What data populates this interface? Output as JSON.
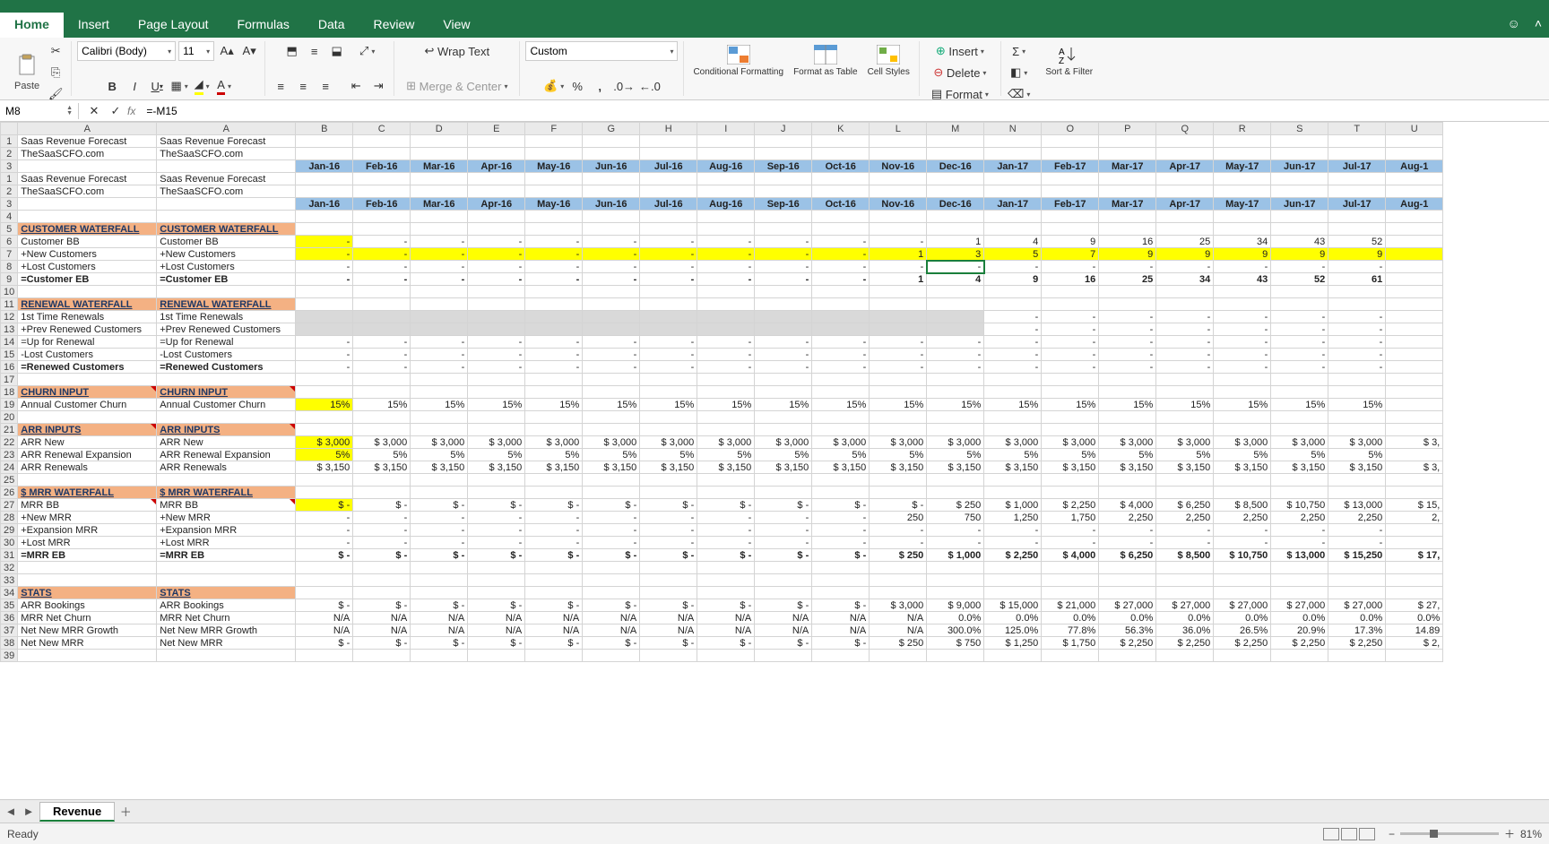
{
  "window": {
    "face_icon": "☺",
    "chevron": "˄",
    "close": "✕"
  },
  "tabs": [
    "Home",
    "Insert",
    "Page Layout",
    "Formulas",
    "Data",
    "Review",
    "View"
  ],
  "active_tab": 0,
  "ribbon": {
    "paste": "Paste",
    "font_family": "Calibri (Body)",
    "font_size": "11",
    "wrap": "Wrap Text",
    "merge": "Merge & Center",
    "num_format": "Custom",
    "cond": "Conditional Formatting",
    "fmt_tbl": "Format as Table",
    "cell_st": "Cell Styles",
    "insert": "Insert",
    "delete": "Delete",
    "format": "Format",
    "sort": "Sort & Filter"
  },
  "name_box": "M8",
  "formula": "=-M15",
  "columns": [
    "",
    "A",
    "A",
    "B",
    "C",
    "D",
    "E",
    "F",
    "G",
    "H",
    "I",
    "J",
    "K",
    "L",
    "M",
    "N",
    "O",
    "P",
    "Q",
    "R",
    "S",
    "T",
    "U"
  ],
  "months": [
    "Jan-16",
    "Feb-16",
    "Mar-16",
    "Apr-16",
    "May-16",
    "Jun-16",
    "Jul-16",
    "Aug-16",
    "Sep-16",
    "Oct-16",
    "Nov-16",
    "Dec-16",
    "Jan-17",
    "Feb-17",
    "Mar-17",
    "Apr-17",
    "May-17",
    "Jun-17",
    "Jul-17",
    "Aug-1"
  ],
  "rowLabels": {
    "title": "Saas Revenue Forecast",
    "src": "TheSaaSCFO.com",
    "cw": "CUSTOMER WATERFALL",
    "cbb": "Customer BB",
    "nc": "+New Customers",
    "lc": "+Lost Customers",
    "ceb": "=Customer EB",
    "rw": "RENEWAL WATERFALL",
    "ftr": "1st Time Renewals",
    "prc": "+Prev Renewed Customers",
    "ufr": "=Up for Renewal",
    "lcc": "-Lost Customers",
    "rc": "=Renewed Customers",
    "ci": "CHURN INPUT",
    "acc": "Annual Customer Churn",
    "ai": "ARR INPUTS",
    "an": "ARR New",
    "are": "ARR Renewal Expansion",
    "ar": "ARR Renewals",
    "mw": "$ MRR WATERFALL",
    "mbb": "MRR BB",
    "nm": "+New MRR",
    "em": "+Expansion MRR",
    "lm": "+Lost MRR",
    "meb": "=MRR EB",
    "st": "STATS",
    "ab": "ARR Bookings",
    "mnc": "MRR Net Churn",
    "nng": "Net New MRR Growth",
    "nnm": "Net New MRR"
  },
  "data": {
    "cbb": [
      "-",
      "-",
      "-",
      "-",
      "-",
      "-",
      "-",
      "-",
      "-",
      "-",
      "-",
      "1",
      "4",
      "9",
      "16",
      "25",
      "34",
      "43",
      "52",
      ""
    ],
    "nc": [
      "-",
      "-",
      "-",
      "-",
      "-",
      "-",
      "-",
      "-",
      "-",
      "-",
      "1",
      "3",
      "5",
      "7",
      "9",
      "9",
      "9",
      "9",
      "9",
      ""
    ],
    "lc": [
      "-",
      "-",
      "-",
      "-",
      "-",
      "-",
      "-",
      "-",
      "-",
      "-",
      "-",
      "-",
      "-",
      "-",
      "-",
      "-",
      "-",
      "-",
      "-",
      ""
    ],
    "ceb": [
      "-",
      "-",
      "-",
      "-",
      "-",
      "-",
      "-",
      "-",
      "-",
      "-",
      "1",
      "4",
      "9",
      "16",
      "25",
      "34",
      "43",
      "52",
      "61",
      ""
    ],
    "ftr": [
      "",
      "",
      "",
      "",
      "",
      "",
      "",
      "",
      "",
      "",
      "",
      "",
      "-",
      "-",
      "-",
      "-",
      "-",
      "-",
      "-",
      ""
    ],
    "prc": [
      "",
      "",
      "",
      "",
      "",
      "",
      "",
      "",
      "",
      "",
      "",
      "",
      "-",
      "-",
      "-",
      "-",
      "-",
      "-",
      "-",
      ""
    ],
    "ufr": [
      "-",
      "-",
      "-",
      "-",
      "-",
      "-",
      "-",
      "-",
      "-",
      "-",
      "-",
      "-",
      "-",
      "-",
      "-",
      "-",
      "-",
      "-",
      "-",
      ""
    ],
    "lcc": [
      "-",
      "-",
      "-",
      "-",
      "-",
      "-",
      "-",
      "-",
      "-",
      "-",
      "-",
      "-",
      "-",
      "-",
      "-",
      "-",
      "-",
      "-",
      "-",
      ""
    ],
    "rc": [
      "-",
      "-",
      "-",
      "-",
      "-",
      "-",
      "-",
      "-",
      "-",
      "-",
      "-",
      "-",
      "-",
      "-",
      "-",
      "-",
      "-",
      "-",
      "-",
      ""
    ],
    "acc": [
      "15%",
      "15%",
      "15%",
      "15%",
      "15%",
      "15%",
      "15%",
      "15%",
      "15%",
      "15%",
      "15%",
      "15%",
      "15%",
      "15%",
      "15%",
      "15%",
      "15%",
      "15%",
      "15%",
      ""
    ],
    "an": [
      "$   3,000",
      "$   3,000",
      "$   3,000",
      "$   3,000",
      "$   3,000",
      "$   3,000",
      "$   3,000",
      "$   3,000",
      "$   3,000",
      "$   3,000",
      "$   3,000",
      "$   3,000",
      "$   3,000",
      "$   3,000",
      "$   3,000",
      "$   3,000",
      "$   3,000",
      "$   3,000",
      "$   3,000",
      "$   3,"
    ],
    "are": [
      "5%",
      "5%",
      "5%",
      "5%",
      "5%",
      "5%",
      "5%",
      "5%",
      "5%",
      "5%",
      "5%",
      "5%",
      "5%",
      "5%",
      "5%",
      "5%",
      "5%",
      "5%",
      "5%",
      ""
    ],
    "ar": [
      "$   3,150",
      "$   3,150",
      "$   3,150",
      "$   3,150",
      "$   3,150",
      "$   3,150",
      "$   3,150",
      "$   3,150",
      "$   3,150",
      "$   3,150",
      "$   3,150",
      "$   3,150",
      "$   3,150",
      "$   3,150",
      "$   3,150",
      "$   3,150",
      "$   3,150",
      "$   3,150",
      "$   3,150",
      "$   3,"
    ],
    "mbb": [
      "$       -",
      "$       -",
      "$       -",
      "$       -",
      "$       -",
      "$       -",
      "$       -",
      "$       -",
      "$       -",
      "$       -",
      "$       -",
      "$     250",
      "$   1,000",
      "$   2,250",
      "$   4,000",
      "$   6,250",
      "$   8,500",
      "$  10,750",
      "$  13,000",
      "$  15,"
    ],
    "nm": [
      "-",
      "-",
      "-",
      "-",
      "-",
      "-",
      "-",
      "-",
      "-",
      "-",
      "250",
      "750",
      "1,250",
      "1,750",
      "2,250",
      "2,250",
      "2,250",
      "2,250",
      "2,250",
      "2,"
    ],
    "em": [
      "-",
      "-",
      "-",
      "-",
      "-",
      "-",
      "-",
      "-",
      "-",
      "-",
      "-",
      "-",
      "-",
      "-",
      "-",
      "-",
      "-",
      "-",
      "-",
      ""
    ],
    "lm": [
      "-",
      "-",
      "-",
      "-",
      "-",
      "-",
      "-",
      "-",
      "-",
      "-",
      "-",
      "-",
      "-",
      "-",
      "-",
      "-",
      "-",
      "-",
      "-",
      ""
    ],
    "meb": [
      "$       -",
      "$       -",
      "$       -",
      "$       -",
      "$       -",
      "$       -",
      "$       -",
      "$       -",
      "$       -",
      "$       -",
      "$     250",
      "$   1,000",
      "$   2,250",
      "$   4,000",
      "$   6,250",
      "$   8,500",
      "$  10,750",
      "$  13,000",
      "$  15,250",
      "$  17,"
    ],
    "ab": [
      "$       -",
      "$       -",
      "$       -",
      "$       -",
      "$       -",
      "$       -",
      "$       -",
      "$       -",
      "$       -",
      "$       -",
      "$   3,000",
      "$   9,000",
      "$  15,000",
      "$  21,000",
      "$  27,000",
      "$  27,000",
      "$  27,000",
      "$  27,000",
      "$  27,000",
      "$  27,"
    ],
    "mnc": [
      "N/A",
      "N/A",
      "N/A",
      "N/A",
      "N/A",
      "N/A",
      "N/A",
      "N/A",
      "N/A",
      "N/A",
      "N/A",
      "0.0%",
      "0.0%",
      "0.0%",
      "0.0%",
      "0.0%",
      "0.0%",
      "0.0%",
      "0.0%",
      "0.0%"
    ],
    "nng": [
      "N/A",
      "N/A",
      "N/A",
      "N/A",
      "N/A",
      "N/A",
      "N/A",
      "N/A",
      "N/A",
      "N/A",
      "N/A",
      "300.0%",
      "125.0%",
      "77.8%",
      "56.3%",
      "36.0%",
      "26.5%",
      "20.9%",
      "17.3%",
      "14.89"
    ],
    "nnm": [
      "$       -",
      "$       -",
      "$       -",
      "$       -",
      "$       -",
      "$       -",
      "$       -",
      "$       -",
      "$       -",
      "$       -",
      "$     250",
      "$     750",
      "$   1,250",
      "$   1,750",
      "$   2,250",
      "$   2,250",
      "$   2,250",
      "$   2,250",
      "$   2,250",
      "$   2,"
    ]
  },
  "sheet_name": "Revenue",
  "status_text": "Ready",
  "zoom": "81%"
}
